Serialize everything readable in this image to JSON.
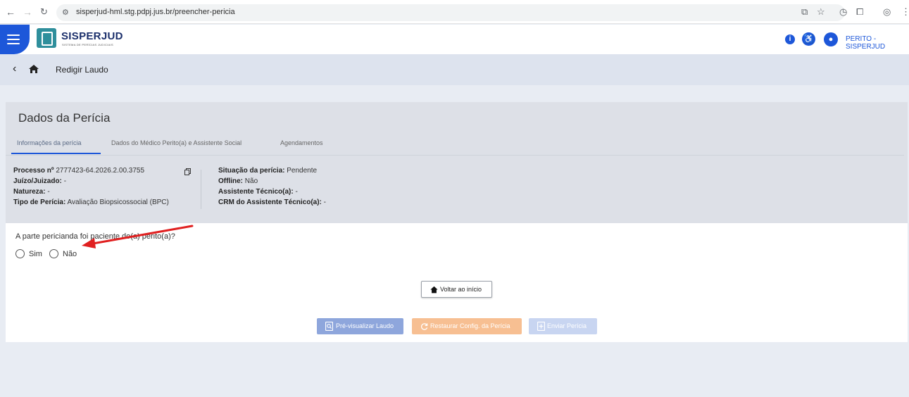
{
  "browser": {
    "url": "sisperjud-hml.stg.pdpj.jus.br/preencher-pericia",
    "icons": [
      "back-arrow-icon",
      "forward-arrow-icon",
      "reload-icon",
      "site-info-icon",
      "install-icon",
      "star-icon",
      "history-icon",
      "extensions-icon",
      "profile-icon",
      "menu-icon"
    ]
  },
  "header": {
    "app_name": "SISPERJUD",
    "app_subtitle": "SISTEMA DE PERÍCIAS JUDICIAIS",
    "user_label": "PERITO - SISPERJUD",
    "brand_color": "#1d57d9"
  },
  "page": {
    "title": "Redigir Laudo"
  },
  "card": {
    "heading": "Dados da Perícia",
    "tabs": [
      {
        "label": "Informações da perícia",
        "active": true
      },
      {
        "label": "Dados do Médico Perito(a) e Assistente Social",
        "active": false
      },
      {
        "label": "Agendamentos",
        "active": false
      }
    ],
    "left": {
      "processo_label": "Processo nº",
      "processo_value": "2777423-64.2026.2.00.3755",
      "juizo_label": "Juízo/Juizado:",
      "juizo_value": "-",
      "natureza_label": "Natureza:",
      "natureza_value": "-",
      "tipo_label": "Tipo de Perícia:",
      "tipo_value": "Avaliação Biopsicossocial (BPC)"
    },
    "right": {
      "situacao_label": "Situação da perícia:",
      "situacao_value": "Pendente",
      "offline_label": "Offline:",
      "offline_value": "Não",
      "assistente_label": "Assistente Técnico(a):",
      "assistente_value": "-",
      "crm_label": "CRM do Assistente Técnico(a):",
      "crm_value": "-"
    }
  },
  "form": {
    "question": "A parte pericianda foi paciente do(a) perito(a)?",
    "options": [
      "Sim",
      "Não"
    ]
  },
  "buttons": {
    "back_home": "Voltar ao início",
    "preview": "Pré-visualizar Laudo",
    "restore": "Restaurar Config. da Perícia",
    "send": "Enviar Perícia"
  }
}
